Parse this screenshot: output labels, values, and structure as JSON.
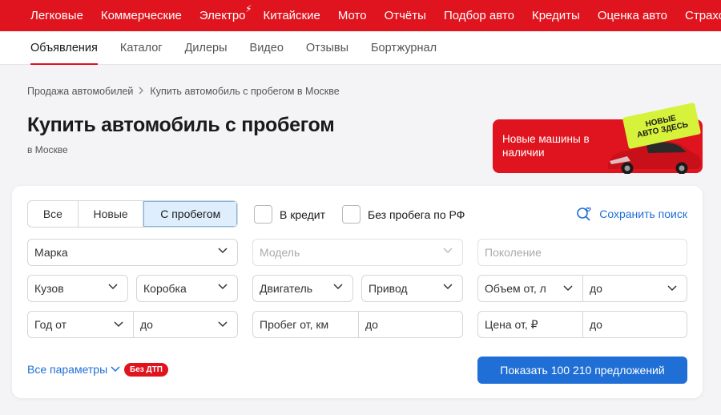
{
  "topnav": {
    "items": [
      "Легковые",
      "Коммерческие",
      "Электро",
      "Китайские",
      "Мото",
      "Отчёты",
      "Подбор авто",
      "Кредиты",
      "Оценка авто",
      "Страховки"
    ]
  },
  "subnav": {
    "items": [
      "Объявления",
      "Каталог",
      "Дилеры",
      "Видео",
      "Отзывы",
      "Бортжурнал"
    ]
  },
  "breadcrumb": {
    "items": [
      "Продажа автомобилей",
      "Купить автомобиль с пробегом в Москве"
    ]
  },
  "header": {
    "title": "Купить автомобиль с пробегом",
    "subtitle": "в Москве"
  },
  "banner": {
    "text": "Новые машины в наличии",
    "sticker_line1": "НОВЫЕ",
    "sticker_line2": "АВТО ЗДЕСЬ"
  },
  "filters": {
    "segments": [
      "Все",
      "Новые",
      "С пробегом"
    ],
    "active_segment": "С пробегом",
    "credit_label": "В кредит",
    "no_rf_mileage_label": "Без пробега по РФ",
    "save_search": "Сохранить поиск",
    "brand": "Марка",
    "model": "Модель",
    "generation": "Поколение",
    "body": "Кузов",
    "gearbox": "Коробка",
    "engine": "Двигатель",
    "drive": "Привод",
    "volume_from": "Объем от, л",
    "volume_to": "до",
    "year_from": "Год от",
    "year_to": "до",
    "mileage_from": "Пробег от, км",
    "mileage_to": "до",
    "price_from": "Цена от, ₽",
    "price_to": "до",
    "all_params": "Все параметры",
    "no_accident_badge": "Без ДТП",
    "show_button": "Показать 100 210 предложений"
  },
  "colors": {
    "brand_red": "#e0141e",
    "link_blue": "#1f6fd6",
    "sticker_green": "#d7f23a"
  }
}
